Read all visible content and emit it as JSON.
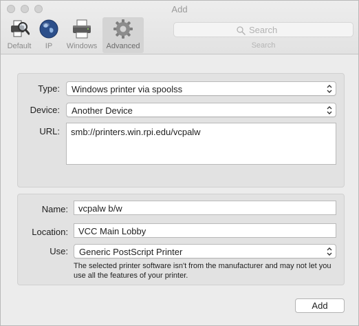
{
  "window": {
    "title": "Add"
  },
  "toolbar": {
    "tabs": [
      {
        "label": "Default",
        "icon": "default-printers-icon"
      },
      {
        "label": "IP",
        "icon": "globe-icon"
      },
      {
        "label": "Windows",
        "icon": "printer-icon"
      },
      {
        "label": "Advanced",
        "icon": "gear-icon",
        "selected": true
      }
    ],
    "search": {
      "placeholder": "Search",
      "caption": "Search"
    }
  },
  "connection": {
    "type_label": "Type:",
    "type_value": "Windows printer via spoolss",
    "device_label": "Device:",
    "device_value": "Another Device",
    "url_label": "URL:",
    "url_value": "smb://printers.win.rpi.edu/vcpalw"
  },
  "printer": {
    "name_label": "Name:",
    "name_value": "vcpalw b/w",
    "location_label": "Location:",
    "location_value": "VCC Main Lobby",
    "use_label": "Use:",
    "use_value": "Generic PostScript Printer",
    "note": "The selected printer software isn't from the manufacturer and may not let you use all the features of your printer."
  },
  "actions": {
    "add_label": "Add"
  }
}
